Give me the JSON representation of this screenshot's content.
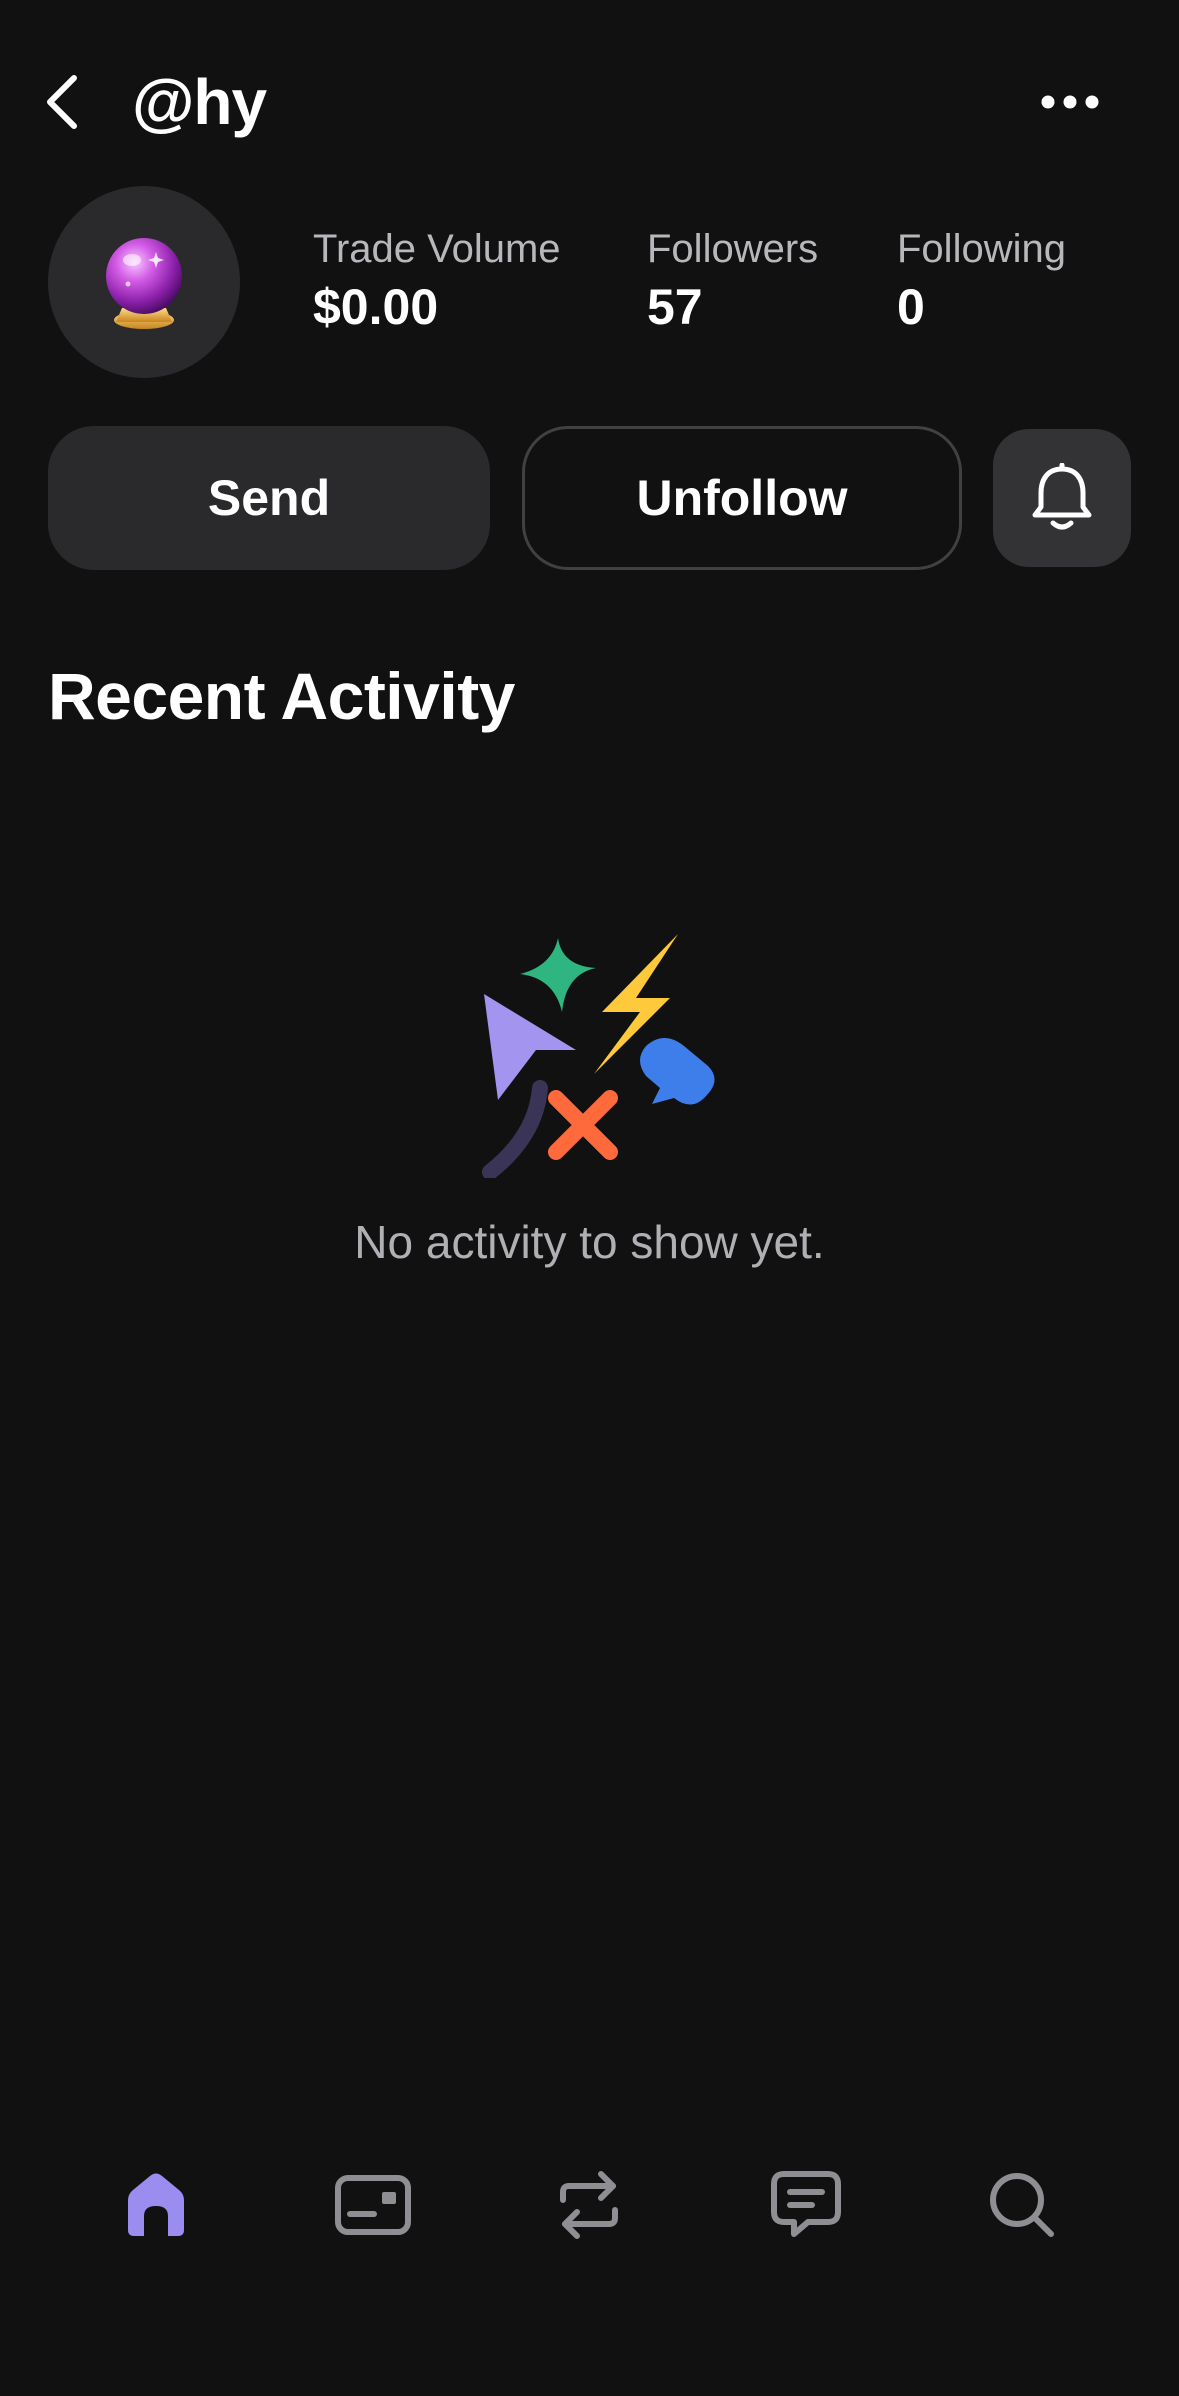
{
  "header": {
    "username": "@hy",
    "back_icon": "chevron-left-icon",
    "more_icon": "more-horizontal-icon"
  },
  "profile": {
    "avatar_icon": "crystal-ball-icon",
    "stats": [
      {
        "label": "Trade Volume",
        "value": "$0.00"
      },
      {
        "label": "Followers",
        "value": "57"
      },
      {
        "label": "Following",
        "value": "0"
      }
    ]
  },
  "actions": {
    "send_label": "Send",
    "unfollow_label": "Unfollow",
    "bell_icon": "bell-icon"
  },
  "activity": {
    "title": "Recent Activity",
    "empty_text": "No activity to show yet.",
    "illustration_icon": "empty-activity-illustration"
  },
  "bottom_nav": {
    "items": [
      {
        "icon": "home-icon",
        "active": true
      },
      {
        "icon": "wallet-card-icon",
        "active": false
      },
      {
        "icon": "swap-arrows-icon",
        "active": false
      },
      {
        "icon": "chat-icon",
        "active": false
      },
      {
        "icon": "search-icon",
        "active": false
      }
    ],
    "active_color": "#9b8cf0",
    "inactive_color": "#8e8e93"
  },
  "colors": {
    "background": "#111112",
    "surface": "#2a2a2c",
    "accent": "#9b8cf0",
    "illustration": [
      "#2fb57f",
      "#ffc93c",
      "#a394f0",
      "#ff6a3d",
      "#3d7eea",
      "#3a3456"
    ]
  }
}
